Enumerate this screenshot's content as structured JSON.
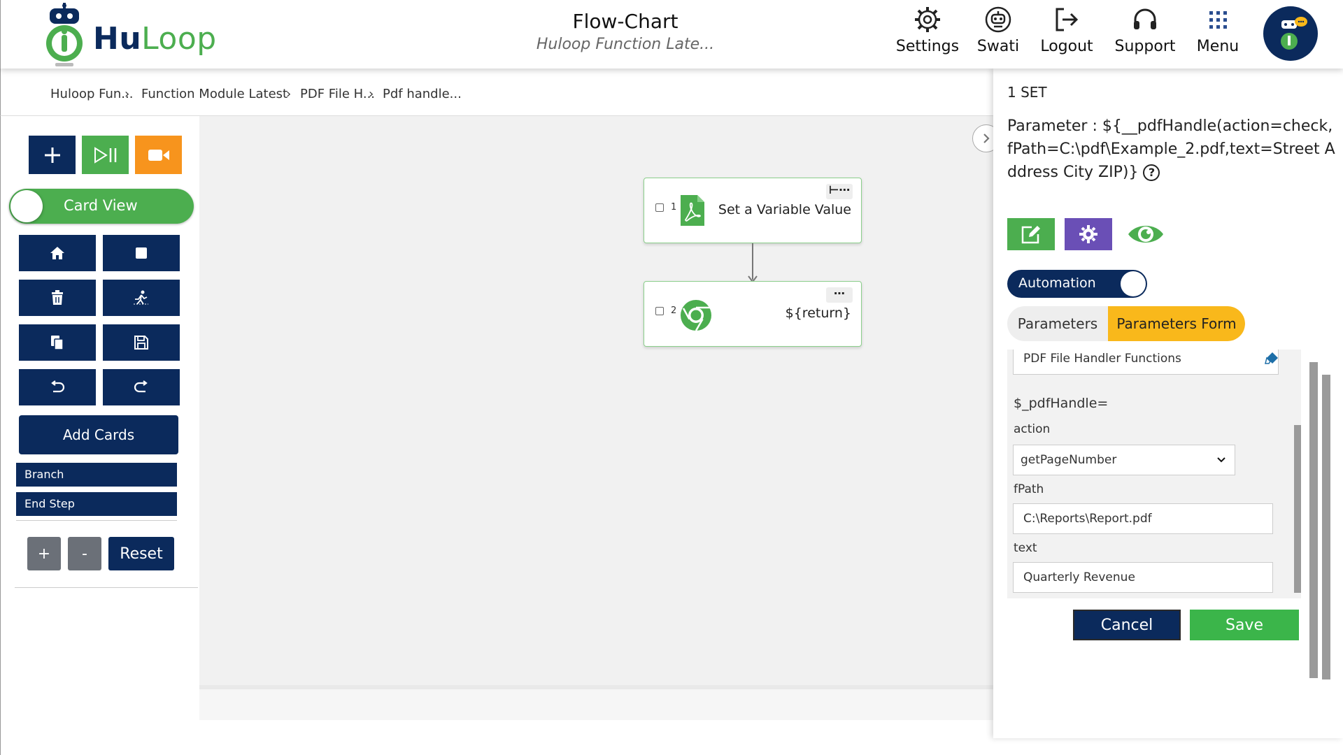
{
  "header": {
    "brand_hu": "Hu",
    "brand_loop": "Loop",
    "title": "Flow-Chart",
    "subtitle": "Huloop Function Late...",
    "nav": [
      {
        "label": "Settings",
        "icon": "gear-icon"
      },
      {
        "label": "Swati",
        "icon": "user-robot-icon"
      },
      {
        "label": "Logout",
        "icon": "logout-icon"
      },
      {
        "label": "Support",
        "icon": "headset-icon"
      },
      {
        "label": "Menu",
        "icon": "grid-icon"
      }
    ]
  },
  "breadcrumb": [
    "Huloop Fun...",
    "Function Module Latest",
    "PDF File H...",
    "Pdf handle..."
  ],
  "toolbar": {
    "card_view_label": "Card View",
    "add_cards_label": "Add Cards",
    "branch_label": "Branch",
    "end_step_label": "End Step",
    "zoom_in_label": "+",
    "zoom_out_label": "-",
    "reset_label": "Reset"
  },
  "flow": {
    "cards": [
      {
        "index": "1",
        "text": "Set a Variable Value",
        "icon": "pdf-icon"
      },
      {
        "index": "2",
        "text": "${return}",
        "icon": "chrome-icon"
      }
    ]
  },
  "panel": {
    "set_label": "1 SET",
    "parameter_text": "Parameter : ${__pdfHandle(action=check,fPath=C:\\pdf\\Example_2.pdf,text=Street Address City ZIP)}",
    "automation_label": "Automation",
    "tab_parameters": "Parameters",
    "tab_parameters_form": "Parameters Form",
    "function_group": "PDF File Handler Functions",
    "function_name": "$_pdfHandle=",
    "action_label": "action",
    "action_value": "getPageNumber",
    "fpath_label": "fPath",
    "fpath_value": "C:\\Reports\\Report.pdf",
    "text_label": "text",
    "text_value": "Quarterly Revenue",
    "cancel_label": "Cancel",
    "save_label": "Save"
  },
  "colors": {
    "navy": "#0b2a5c",
    "green": "#4cae4f",
    "orange": "#f7941d",
    "purple": "#6a4fb6",
    "tab_active": "#f9b81b"
  }
}
